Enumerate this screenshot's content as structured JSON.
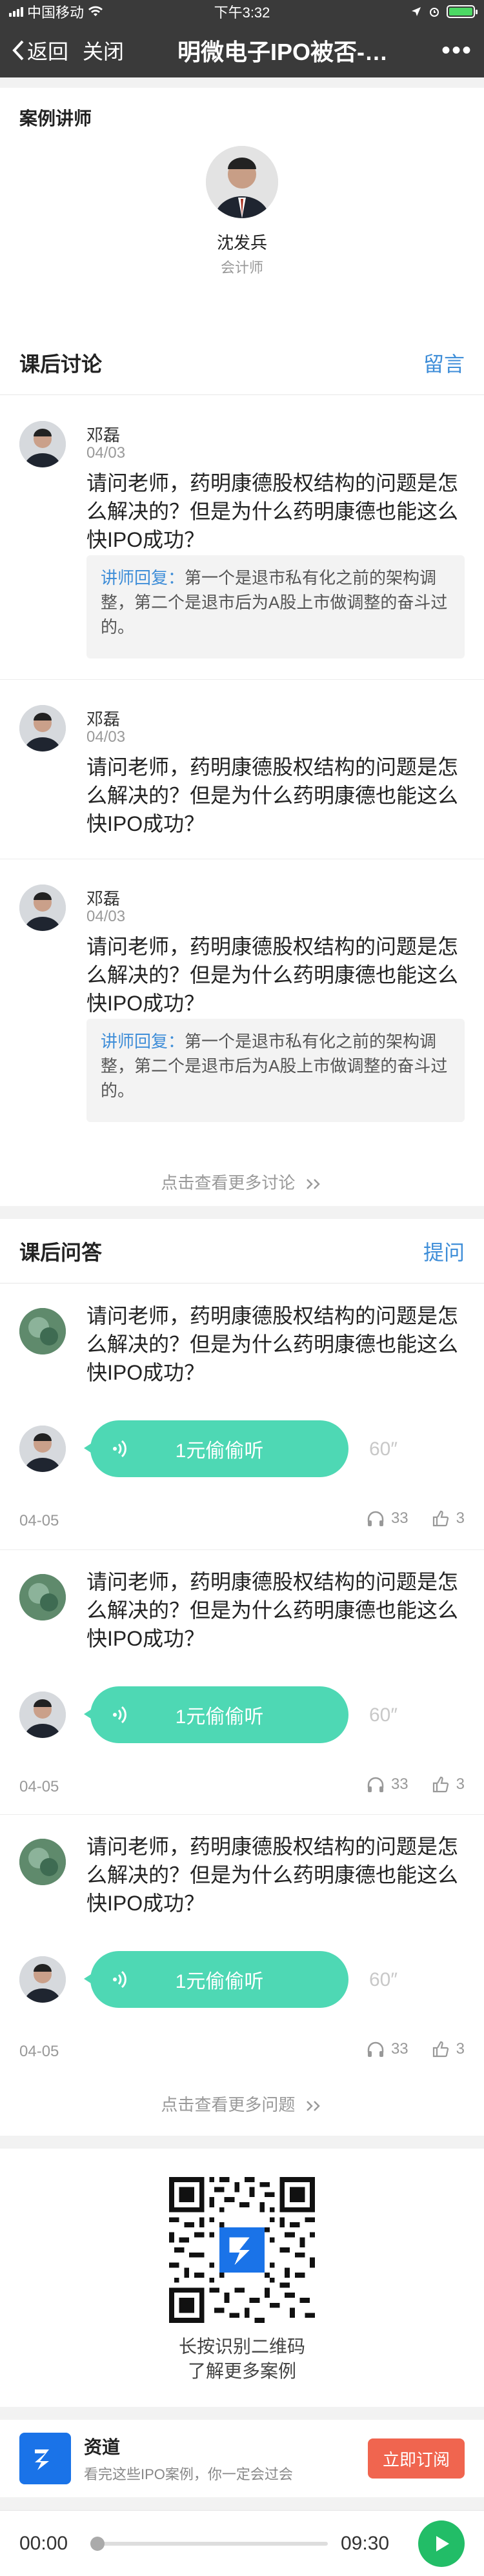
{
  "status": {
    "carrier": "中国移动",
    "time": "下午3:32"
  },
  "nav": {
    "back": "返回",
    "close": "关闭",
    "title": "明微电子IPO被否-…",
    "more": "•••"
  },
  "lecturer": {
    "heading": "案例讲师",
    "name": "沈发兵",
    "role": "会计师"
  },
  "discussion": {
    "title": "课后讨论",
    "action": "留言",
    "more": "点击查看更多讨论",
    "items": [
      {
        "name": "邓磊",
        "date": "04/03",
        "text": "请问老师，药明康德股权结构的问题是怎么解决的？但是为什么药明康德也能这么快IPO成功？",
        "reply_label": "讲师回复：",
        "reply": "第一个是退市私有化之前的架构调整，第二个是退市后为A股上市做调整的奋斗过的。"
      },
      {
        "name": "邓磊",
        "date": "04/03",
        "text": "请问老师，药明康德股权结构的问题是怎么解决的？但是为什么药明康德也能这么快IPO成功？"
      },
      {
        "name": "邓磊",
        "date": "04/03",
        "text": "请问老师，药明康德股权结构的问题是怎么解决的？但是为什么药明康德也能这么快IPO成功？",
        "reply_label": "讲师回复：",
        "reply": "第一个是退市私有化之前的架构调整，第二个是退市后为A股上市做调整的奋斗过的。"
      }
    ]
  },
  "qa": {
    "title": "课后问答",
    "action": "提问",
    "more": "点击查看更多问题",
    "items": [
      {
        "text": "请问老师，药明康德股权结构的问题是怎么解决的？但是为什么药明康德也能这么快IPO成功？",
        "audio_label": "1元偷偷听",
        "duration": "60″",
        "date": "04-05",
        "listens": "33",
        "likes": "3"
      },
      {
        "text": "请问老师，药明康德股权结构的问题是怎么解决的？但是为什么药明康德也能这么快IPO成功？",
        "audio_label": "1元偷偷听",
        "duration": "60″",
        "date": "04-05",
        "listens": "33",
        "likes": "3"
      },
      {
        "text": "请问老师，药明康德股权结构的问题是怎么解决的？但是为什么药明康德也能这么快IPO成功？",
        "audio_label": "1元偷偷听",
        "duration": "60″",
        "date": "04-05",
        "listens": "33",
        "likes": "3"
      }
    ]
  },
  "qr": {
    "line1": "长按识别二维码",
    "line2": "了解更多案例"
  },
  "promo": {
    "name": "资道",
    "sub": "看完这些IPO案例，你一定会过会",
    "button": "立即订阅"
  },
  "player": {
    "current": "00:00",
    "total": "09:30",
    "progress": 0
  },
  "colors": {
    "accent": "#3f8ed8",
    "audio": "#4ed8b4",
    "subscribe": "#f0654f",
    "play": "#22bd67"
  }
}
